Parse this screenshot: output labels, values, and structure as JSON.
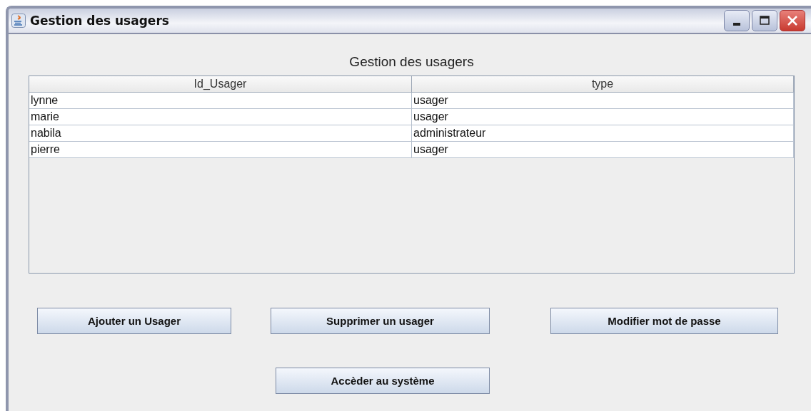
{
  "window": {
    "title": "Gestion des usagers"
  },
  "heading": "Gestion des usagers",
  "table": {
    "columns": [
      "Id_Usager",
      "type"
    ],
    "rows": [
      [
        "lynne",
        "usager"
      ],
      [
        "marie",
        "usager"
      ],
      [
        "nabila",
        "administrateur"
      ],
      [
        "pierre",
        "usager"
      ]
    ]
  },
  "buttons": [
    "Ajouter un Usager",
    "Supprimer un usager",
    "Modifier mot de passe"
  ],
  "bottom_button": "Accèder au système"
}
